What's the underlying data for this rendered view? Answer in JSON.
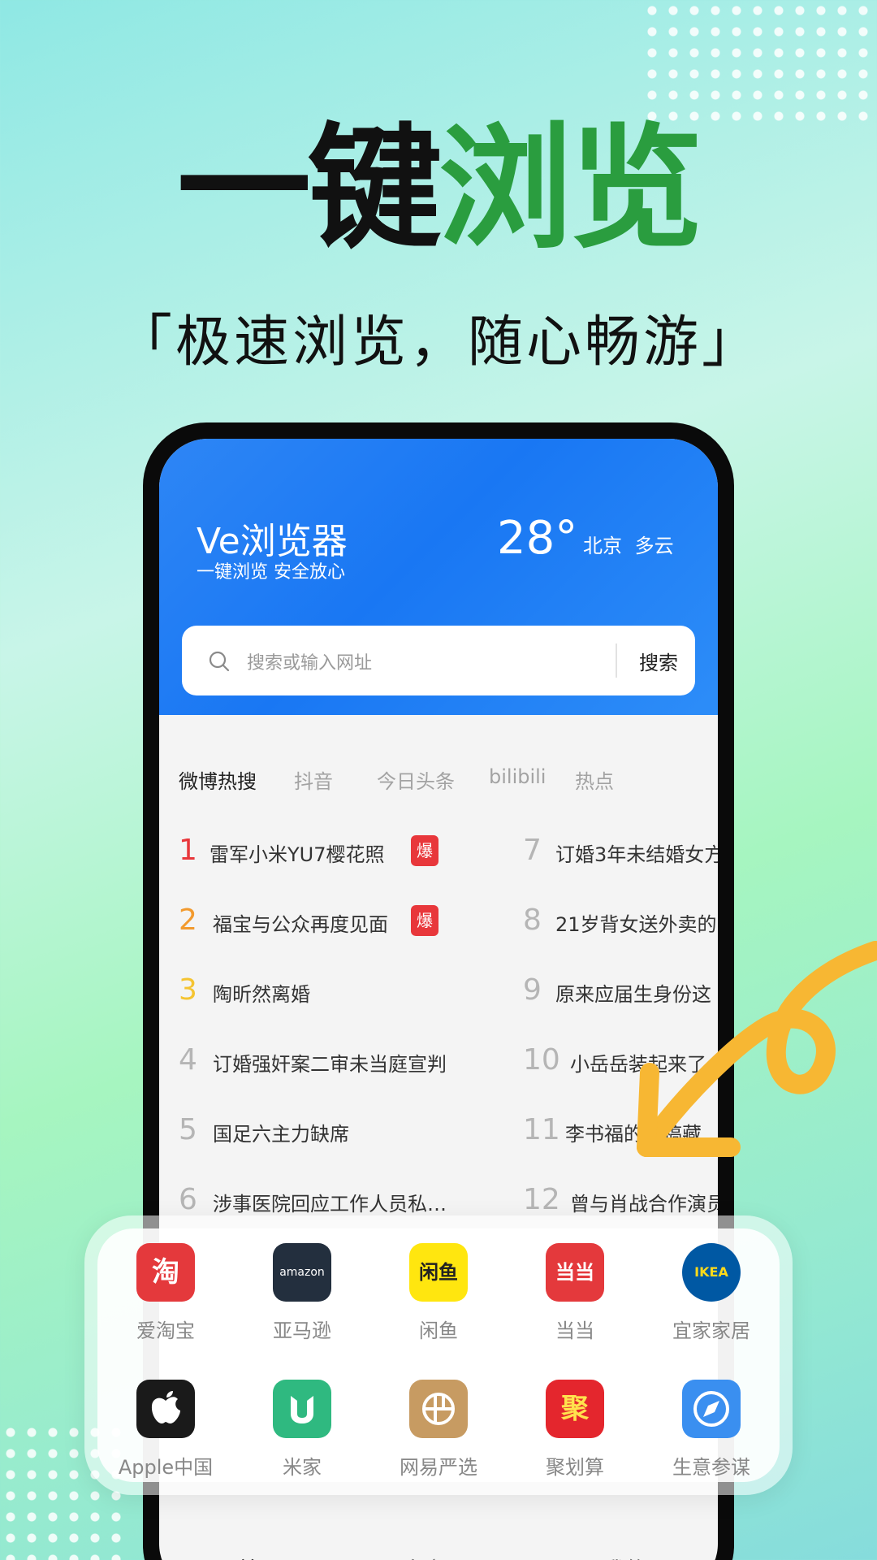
{
  "hero": {
    "title_black": "一键",
    "title_green": "浏览",
    "subtitle_open": "「",
    "subtitle": "极速浏览，随心畅游",
    "subtitle_close": "」"
  },
  "header": {
    "app_name": "Ve浏览器",
    "tagline": "一键浏览 安全放心",
    "temperature": "28°",
    "weather": "北京 多云"
  },
  "search": {
    "placeholder": "搜索或输入网址",
    "button": "搜索"
  },
  "tabs": [
    {
      "label": "微博热搜",
      "active": true
    },
    {
      "label": "抖音",
      "active": false
    },
    {
      "label": "今日头条",
      "active": false
    },
    {
      "label": "bilibili",
      "active": false
    },
    {
      "label": "热点",
      "active": false
    }
  ],
  "hot_list_left": [
    {
      "rank": "1",
      "text": "雷军小米YU7樱花照",
      "badge": "爆"
    },
    {
      "rank": "2",
      "text": "福宝与公众再度见面",
      "badge": "爆"
    },
    {
      "rank": "3",
      "text": "陶昕然离婚",
      "badge": ""
    },
    {
      "rank": "4",
      "text": "订婚强奸案二审未当庭宣判",
      "badge": ""
    },
    {
      "rank": "5",
      "text": "国足六主力缺席",
      "badge": ""
    },
    {
      "rank": "6",
      "text": "涉事医院回应工作人员私…",
      "badge": ""
    }
  ],
  "hot_list_right": [
    {
      "rank": "7",
      "text": "订婚3年未结婚女方"
    },
    {
      "rank": "8",
      "text": "21岁背女送外卖的"
    },
    {
      "rank": "9",
      "text": "原来应届生身份这"
    },
    {
      "rank": "10",
      "text": "小岳岳装起来了"
    },
    {
      "rank": "11",
      "text": "李书福的手稿藏"
    },
    {
      "rank": "12",
      "text": "曾与肖战合作演员"
    }
  ],
  "rank_colors": {
    "1": "#e8373b",
    "2": "#f29a2e",
    "3": "#f5c431",
    "default": "#b5b5b5"
  },
  "shortcuts": [
    {
      "label": "爱淘宝",
      "icon_text": "淘",
      "icon": "taobao-icon",
      "bg": "#e4393c",
      "fg": "#ffffff"
    },
    {
      "label": "亚马逊",
      "icon_text": "amazon",
      "icon": "amazon-icon",
      "bg": "#232f3e",
      "fg": "#ffffff"
    },
    {
      "label": "闲鱼",
      "icon_text": "闲鱼",
      "icon": "xianyu-icon",
      "bg": "#ffe60f",
      "fg": "#222222"
    },
    {
      "label": "当当",
      "icon_text": "当当",
      "icon": "dangdang-icon",
      "bg": "#e4393c",
      "fg": "#ffffff"
    },
    {
      "label": "宜家家居",
      "icon_text": "IKEA",
      "icon": "ikea-icon",
      "bg": "#0058a3",
      "fg": "#ffda1a"
    },
    {
      "label": "Apple中国",
      "icon_text": "",
      "icon": "apple-icon",
      "bg": "#1a1a1a",
      "fg": "#ffffff"
    },
    {
      "label": "米家",
      "icon_text": "",
      "icon": "mijia-icon",
      "bg": "#2fb980",
      "fg": "#ffffff"
    },
    {
      "label": "网易严选",
      "icon_text": "",
      "icon": "yanxuan-icon",
      "bg": "#c79b62",
      "fg": "#ffffff"
    },
    {
      "label": "聚划算",
      "icon_text": "聚",
      "icon": "juhuasuan-icon",
      "bg": "#e4262d",
      "fg": "#ffe24d"
    },
    {
      "label": "生意参谋",
      "icon_text": "",
      "icon": "compass-icon",
      "bg": "#3a8ff0",
      "fg": "#ffffff"
    }
  ],
  "bottom_nav": [
    {
      "label": "首页"
    },
    {
      "label": "多窗口"
    },
    {
      "label": "我的"
    }
  ],
  "colors": {
    "accent_blue": "#1977f3",
    "title_green": "#2a9d3f",
    "arrow_orange": "#f7b733"
  }
}
